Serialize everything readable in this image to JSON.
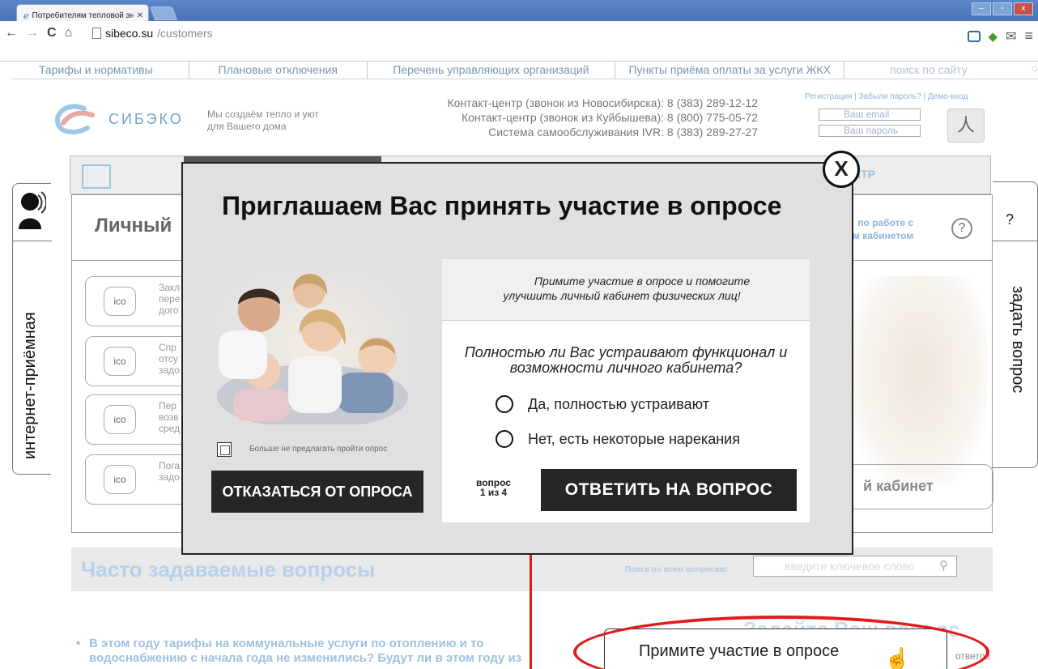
{
  "browser": {
    "tab_title": "Потребителям тепловой эн",
    "url_host": "sibeco.su",
    "url_path": "/customers"
  },
  "topnav": {
    "items": [
      "Тарифы и нормативы",
      "Плановые отключения",
      "Перечень управляющих организаций",
      "Пункты приёма оплаты за услуги ЖКХ"
    ],
    "search_placeholder": "поиск по сайту"
  },
  "header": {
    "brand": "СИБЭКО",
    "tagline_1": "Мы создаём тепло и уют",
    "tagline_2": "для Вашего дома",
    "contact_1": "Контакт-центр (звонок из Новосибирска): 8 (383) 289-12-12",
    "contact_2": "Контакт-центр (звонок из Куйбышева): 8 (800) 775-05-72",
    "contact_3": "Система самообслуживания IVR: 8 (383) 289-27-27",
    "reg_links": "Регистрация | Забыли пароль? | Демо-вход",
    "email_placeholder": "Ваш email",
    "password_placeholder": "Ваш пароль"
  },
  "menubar": {
    "centr_label": "НТР"
  },
  "cabinet": {
    "title": "Личный",
    "help_1": "по работе с",
    "help_2": "м кабинетом",
    "help_q": "?",
    "services": [
      {
        "icon": "ico",
        "l1": "Закл",
        "l2": "пере",
        "l3": "дого"
      },
      {
        "icon": "ico",
        "l1": "Спр",
        "l2": "отсу",
        "l3": "задо"
      },
      {
        "icon": "ico",
        "l1": "Пер",
        "l2": "возв",
        "l3": "сред"
      },
      {
        "icon": "ico",
        "l1": "Пога",
        "l2": "задо",
        "l3": ""
      }
    ],
    "enter_label": "й кабинет"
  },
  "faq": {
    "title": "Часто задаваемые вопросы",
    "search_label": "Поиск по всем вопросам:",
    "search_placeholder": "введите ключевое слово",
    "item_1": "В этом году тарифы на коммунальные услуги по отоплению и то",
    "item_2": "водоснабжению с начала года не изменились? Будут ли в этом году из",
    "ask_heading": "Задайте Ваш вопрос",
    "answers": "ответов"
  },
  "side_left": {
    "label": "интернет-приёмная"
  },
  "side_right": {
    "q": "?",
    "label": "задать вопрос"
  },
  "modal": {
    "close": "X",
    "title": "Приглашаем Вас принять участие в опросе",
    "noshow_label": "Больше не предлагать пройти опрос",
    "decline_button": "ОТКАЗАТЬСЯ ОТ ОПРОСА",
    "intro_1": "Примите участие в опросе и помогите",
    "intro_2": "улучшить личный кабинет физических лиц!",
    "question_1": "Полностью ли Вас устраивают функционал и",
    "question_2": "возможности личного кабинета?",
    "option_1": "Да, полностью устраивают",
    "option_2": "Нет, есть некоторые нарекания",
    "counter_1": "вопрос",
    "counter_2": "1 из 4",
    "answer_button": "ОТВЕТИТЬ НА ВОПРОС"
  },
  "cta": {
    "label": "Примите участие в опросе"
  },
  "colors": {
    "accent_red": "#e01b1b",
    "button_dark": "#262626",
    "link_blue": "#7a95b3"
  }
}
